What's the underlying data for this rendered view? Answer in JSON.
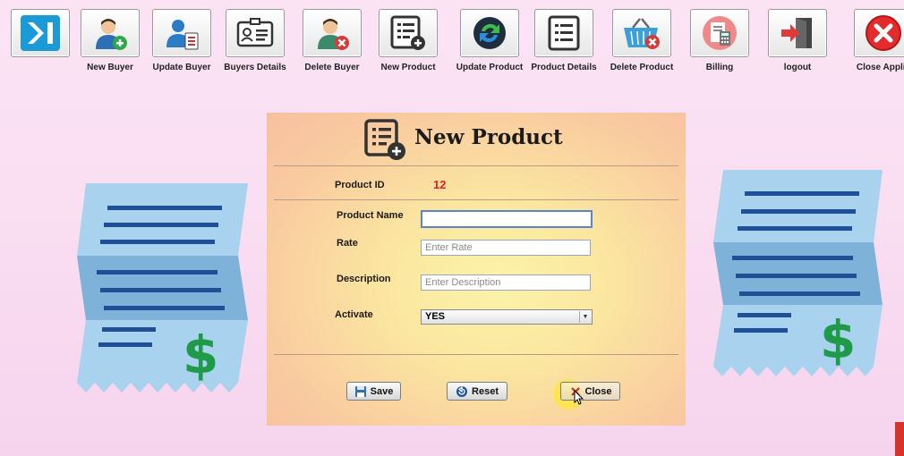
{
  "toolbar": {
    "items": [
      {
        "label": "",
        "icon": "sidebar-toggle-icon"
      },
      {
        "label": "New Buyer",
        "icon": "user-add-icon"
      },
      {
        "label": "Update Buyer",
        "icon": "user-edit-icon"
      },
      {
        "label": "Buyers Details",
        "icon": "id-card-icon"
      },
      {
        "label": "Delete Buyer",
        "icon": "user-delete-icon"
      },
      {
        "label": "New Product",
        "icon": "list-add-icon"
      },
      {
        "label": "Update Product",
        "icon": "refresh-icon"
      },
      {
        "label": "Product Details",
        "icon": "list-icon"
      },
      {
        "label": "Delete Product",
        "icon": "basket-delete-icon"
      },
      {
        "label": "Billing",
        "icon": "bill-calculator-icon"
      },
      {
        "label": "logout",
        "icon": "exit-door-icon"
      },
      {
        "label": "Close Applic",
        "icon": "close-circle-icon"
      }
    ]
  },
  "form": {
    "title": "New Product",
    "product_id_label": "Product ID",
    "product_id_value": "12",
    "product_name_label": "Product Name",
    "product_name_value": "",
    "rate_label": "Rate",
    "rate_placeholder": "Enter Rate",
    "description_label": "Description",
    "description_placeholder": "Enter Description",
    "activate_label": "Activate",
    "activate_value": "YES",
    "save_label": "Save",
    "reset_label": "Reset",
    "close_label": "Close"
  },
  "colors": {
    "accent_red": "#e02020",
    "receipt_line": "#1f4f96",
    "dollar": "#1e9a48"
  }
}
